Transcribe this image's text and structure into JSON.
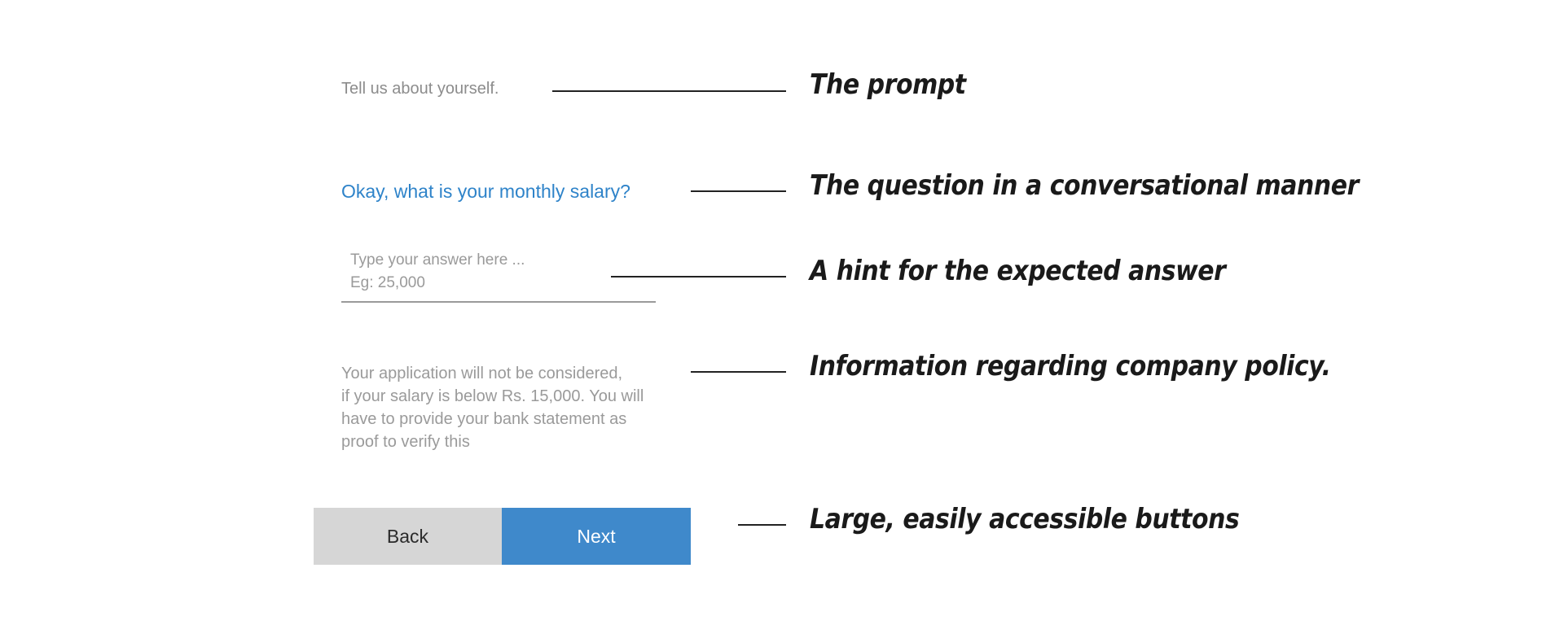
{
  "form": {
    "prompt": "Tell us about yourself.",
    "question": "Okay, what is your monthly salary?",
    "answer_placeholder_line1": "Type your answer here ...",
    "answer_placeholder_line2": "Eg: 25,000",
    "policy_lines": [
      "Your application will not be considered,",
      "if your salary is below Rs. 15,000. You will",
      "have to provide your bank statement as",
      "proof to verify this"
    ],
    "back_label": "Back",
    "next_label": "Next"
  },
  "annotations": {
    "prompt": "The prompt",
    "question": "The question in a conversational manner",
    "hint": "A hint for the expected answer",
    "policy": "Information regarding company policy.",
    "buttons": "Large, easily accessible buttons"
  },
  "colors": {
    "accent_blue": "#3f89cb",
    "question_blue": "#2e83c9",
    "back_gray": "#d6d6d6",
    "muted_text": "#9a9a9a"
  }
}
